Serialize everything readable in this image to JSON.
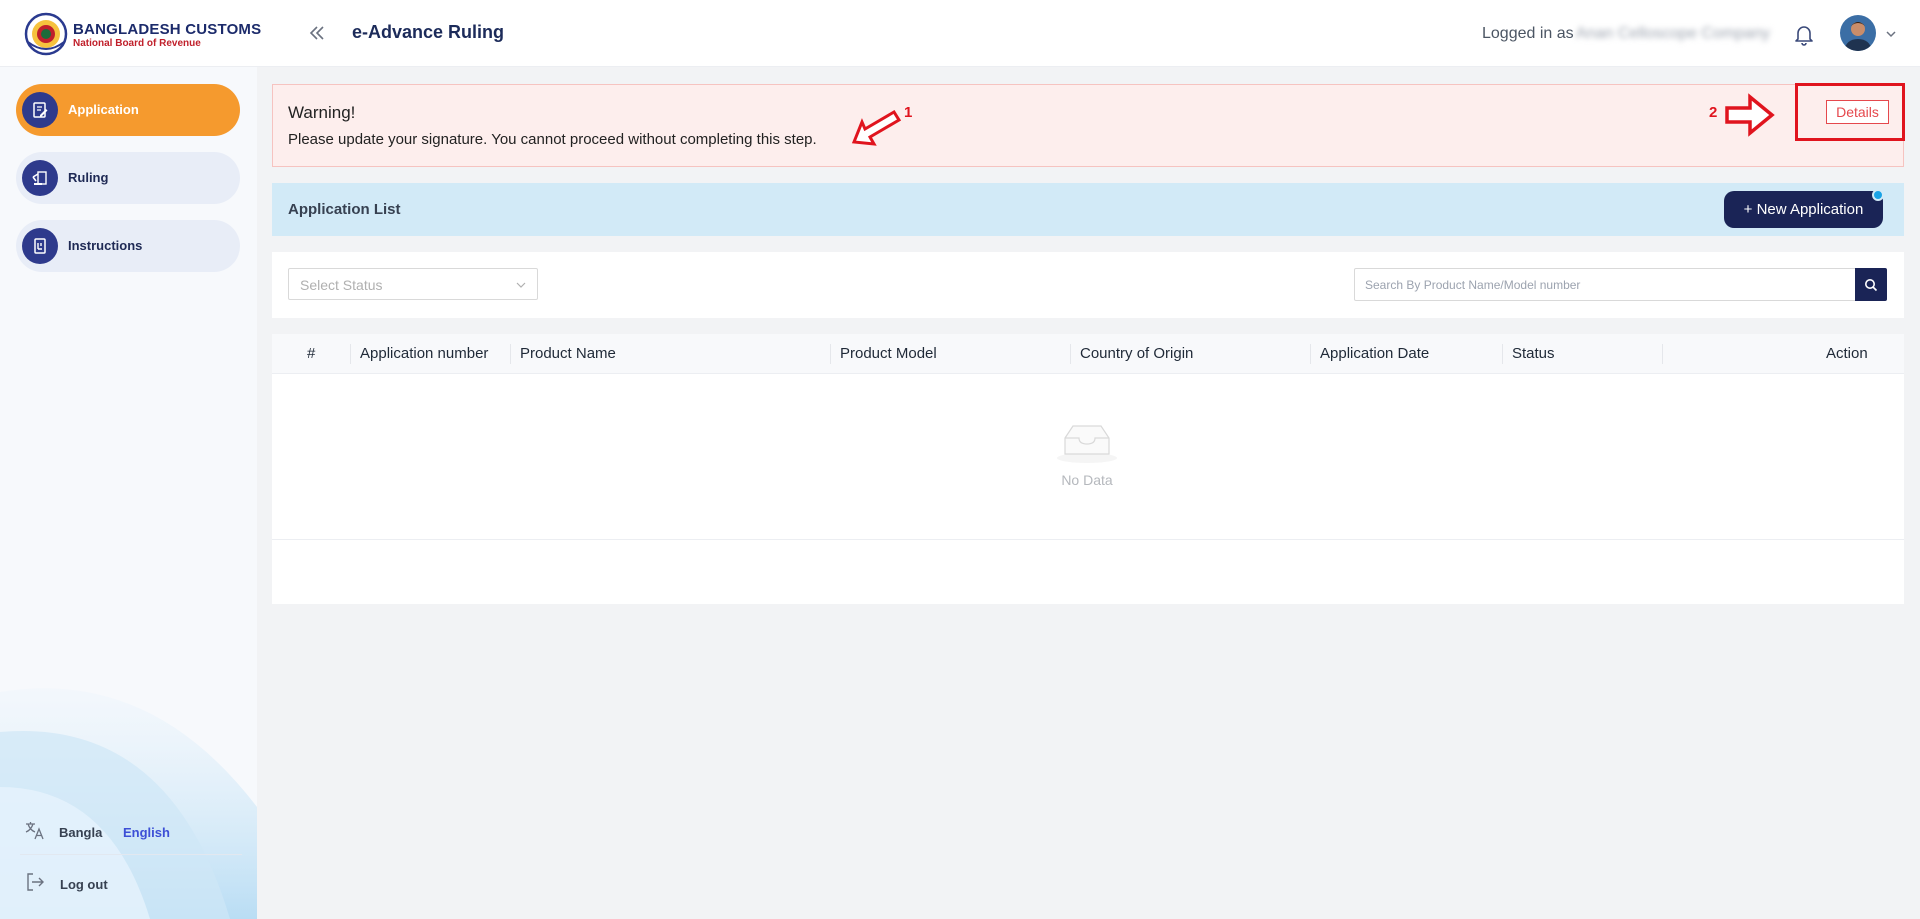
{
  "header": {
    "brand_title": "BANGLADESH CUSTOMS",
    "brand_subtitle": "National Board of Revenue",
    "app_title": "e-Advance Ruling",
    "logged_in_label": "Logged in as",
    "logged_in_user": "Anan Celloscope Company"
  },
  "sidebar": {
    "items": [
      {
        "label": "Application",
        "icon": "application-form-icon",
        "active": true
      },
      {
        "label": "Ruling",
        "icon": "ruling-icon",
        "active": false
      },
      {
        "label": "Instructions",
        "icon": "instructions-book-icon",
        "active": false
      }
    ],
    "lang_bangla": "Bangla",
    "lang_english": "English",
    "active_language": "English",
    "logout_label": "Log out"
  },
  "warning": {
    "title": "Warning!",
    "message": "Please update your signature. You cannot proceed without completing this step.",
    "details_label": "Details",
    "annotation_1": "1",
    "annotation_2": "2"
  },
  "list": {
    "title": "Application List",
    "new_button": "+ New Application"
  },
  "filters": {
    "status_placeholder": "Select Status",
    "search_placeholder": "Search By Product Name/Model number"
  },
  "table": {
    "columns": [
      "#",
      "Application number",
      "Product Name",
      "Product Model",
      "Country of Origin",
      "Application Date",
      "Status",
      "Action"
    ],
    "rows": [],
    "empty_text": "No Data"
  },
  "colors": {
    "accent": "#f59a2e",
    "primary_navy": "#1a2456",
    "annotation_red": "#e0141e",
    "warning_bg": "#fdeeed",
    "list_bar_bg": "#d2eaf7"
  }
}
